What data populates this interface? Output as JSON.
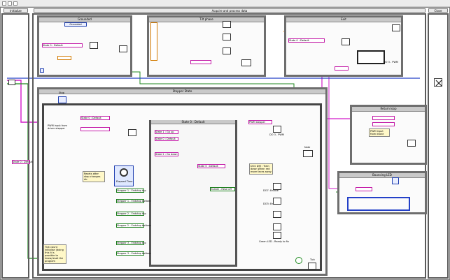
{
  "toolbar": {
    "buttons": [
      "run",
      "abort",
      "pause"
    ]
  },
  "frames": {
    "initialize": "Initialize",
    "acquire": "Acquire and process data",
    "close": "Close"
  },
  "cases": {
    "grounded": "Grounded",
    "tilt": "Tilt phase",
    "exit": "Exit",
    "stepper": "Stepper State",
    "return": "Return loop",
    "bouncing": "Bouncing LED"
  },
  "labels": {
    "grounded_inner": "Grounded",
    "stop": "Stop",
    "pwm_input": "PWM input from driver stepper",
    "elapsed": "Elapsed Time",
    "resets": "Resets after step changes dir.",
    "tick_comment": "Tick count initialise (doing this it is possible to know/reset the program",
    "tick": "Tick",
    "state_default": "State 0 : Default",
    "state_inner": "State 0 : Default",
    "go_up": "State 1 : Go up",
    "default2": "State 0 : Default",
    "go_down": "State 2 : Go down",
    "state_out": "State 0 : Default",
    "enable_false": "Enable - False off",
    "ddo_drv": "DO2 DIR : Train down When red more faces away",
    "ddo_enable": "DO7: Enable",
    "ddo_enable2": "DO3: Enable",
    "green_led": "Green LED - Ready to fix",
    "pwm_stepper": "PWM stepper",
    "do_pwm": "DO 3 - PWM",
    "pwm_input2": "PWM input from drone",
    "note": "Note"
  },
  "steppers": [
    "Stepper 1 - Endstop top",
    "Stepper 1 - Endstop bottom",
    "Stepper 2 - Endstop top",
    "Stepper 2 - Endstop bottom",
    "Stepper 3 - Endstop top",
    "Stepper 3 - Endstop bottom"
  ],
  "numbers": {
    "c1": "1",
    "c0": "0",
    "c2": "2",
    "c3": "3",
    "c50": "50",
    "c100": "100",
    "c255": "255"
  },
  "colors": {
    "wire_pink": "#d21bc9",
    "wire_orange": "#ff8a00",
    "wire_green": "#1f8a1f",
    "wire_blue": "#2441c8",
    "frame": "#5a5a5a"
  }
}
